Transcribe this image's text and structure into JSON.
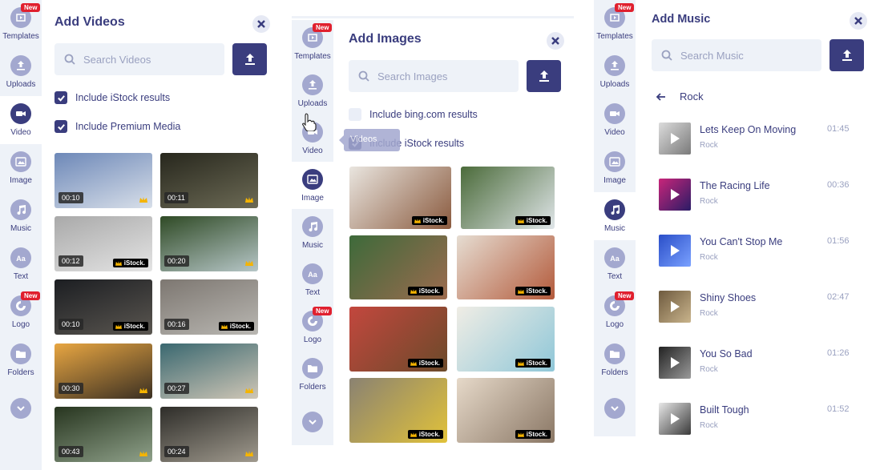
{
  "panel1": {
    "rail": [
      {
        "label": "Templates",
        "icon": "templates-icon",
        "badge": "New",
        "active": false
      },
      {
        "label": "Uploads",
        "icon": "uploads-icon",
        "active": false
      },
      {
        "label": "Video",
        "icon": "video-icon",
        "active": true
      },
      {
        "label": "Image",
        "icon": "image-icon",
        "active": false
      },
      {
        "label": "Music",
        "icon": "music-icon",
        "active": false
      },
      {
        "label": "Text",
        "icon": "text-icon",
        "active": false
      },
      {
        "label": "Logo",
        "icon": "logo-icon",
        "badge": "New",
        "active": false
      },
      {
        "label": "Folders",
        "icon": "folders-icon",
        "active": false
      },
      {
        "label": "",
        "icon": "chevron-down-icon",
        "active": false
      }
    ],
    "title": "Add Videos",
    "search_placeholder": "Search Videos",
    "checks": [
      {
        "label": "Include iStock results",
        "checked": true
      },
      {
        "label": "Include Premium Media",
        "checked": true
      }
    ],
    "videos": [
      {
        "duration": "00:10",
        "mark": "crown",
        "colors": [
          "#6d88b8",
          "#d8dfe9"
        ]
      },
      {
        "duration": "00:11",
        "mark": "crown",
        "colors": [
          "#27271d",
          "#6c6a55"
        ]
      },
      {
        "duration": "00:12",
        "mark": "iStock.",
        "colors": [
          "#a9a9a9",
          "#e4e4e4"
        ]
      },
      {
        "duration": "00:20",
        "mark": "crown",
        "colors": [
          "#2f4a25",
          "#b6c6c7"
        ]
      },
      {
        "duration": "00:10",
        "mark": "iStock.",
        "colors": [
          "#1c1e22",
          "#5a5650"
        ]
      },
      {
        "duration": "00:16",
        "mark": "iStock.",
        "colors": [
          "#7d7771",
          "#b9b7b2"
        ]
      },
      {
        "duration": "00:30",
        "mark": "crown",
        "colors": [
          "#e8a642",
          "#3a2f22"
        ]
      },
      {
        "duration": "00:27",
        "mark": "crown",
        "colors": [
          "#3a6870",
          "#cfc6b6"
        ]
      },
      {
        "duration": "00:43",
        "mark": "crown",
        "colors": [
          "#27351f",
          "#8fa18a"
        ]
      },
      {
        "duration": "00:24",
        "mark": "crown",
        "colors": [
          "#2e2d29",
          "#a09a8e"
        ]
      }
    ]
  },
  "panel2": {
    "rail": [
      {
        "label": "Templates",
        "icon": "templates-icon",
        "badge": "New",
        "active": false
      },
      {
        "label": "Uploads",
        "icon": "uploads-icon",
        "active": false
      },
      {
        "label": "Video",
        "icon": "video-icon",
        "active": false
      },
      {
        "label": "Image",
        "icon": "image-icon",
        "active": true
      },
      {
        "label": "Music",
        "icon": "music-icon",
        "active": false
      },
      {
        "label": "Text",
        "icon": "text-icon",
        "active": false
      },
      {
        "label": "Logo",
        "icon": "logo-icon",
        "badge": "New",
        "active": false
      },
      {
        "label": "Folders",
        "icon": "folders-icon",
        "active": false
      },
      {
        "label": "",
        "icon": "chevron-down-icon",
        "active": false
      }
    ],
    "title": "Add Images",
    "search_placeholder": "Search Images",
    "checks": [
      {
        "label": "Include bing.com results",
        "checked": false
      },
      {
        "label": "Include iStock results",
        "checked": true
      }
    ],
    "tooltip": "Videos",
    "images": [
      {
        "mark": "iStock.",
        "colors": [
          "#e9e5df",
          "#8a5a3e"
        ]
      },
      {
        "mark": "iStock.",
        "colors": [
          "#4b6b3a",
          "#dfe5e8"
        ]
      },
      {
        "mark": "iStock.",
        "colors": [
          "#3d6a3a",
          "#9c6b4f"
        ]
      },
      {
        "mark": "iStock.",
        "colors": [
          "#e6ddd2",
          "#b35a3b"
        ]
      },
      {
        "mark": "iStock.",
        "colors": [
          "#c3473e",
          "#6b4a2a"
        ]
      },
      {
        "mark": "iStock.",
        "colors": [
          "#f0ede5",
          "#8fc7d8"
        ]
      },
      {
        "mark": "iStock.",
        "colors": [
          "#8a8272",
          "#e1c23a"
        ]
      },
      {
        "mark": "iStock.",
        "colors": [
          "#e6d9c9",
          "#8a7765"
        ]
      }
    ]
  },
  "panel3": {
    "rail": [
      {
        "label": "Templates",
        "icon": "templates-icon",
        "badge": "New",
        "active": false
      },
      {
        "label": "Uploads",
        "icon": "uploads-icon",
        "active": false
      },
      {
        "label": "Video",
        "icon": "video-icon",
        "active": false
      },
      {
        "label": "Image",
        "icon": "image-icon",
        "active": false
      },
      {
        "label": "Music",
        "icon": "music-icon",
        "active": true
      },
      {
        "label": "Text",
        "icon": "text-icon",
        "active": false
      },
      {
        "label": "Logo",
        "icon": "logo-icon",
        "badge": "New",
        "active": false
      },
      {
        "label": "Folders",
        "icon": "folders-icon",
        "active": false
      },
      {
        "label": "",
        "icon": "chevron-down-icon",
        "active": false
      }
    ],
    "title": "Add Music",
    "search_placeholder": "Search Music",
    "genre": "Rock",
    "tracks": [
      {
        "name": "Lets Keep On Moving",
        "genre": "Rock",
        "duration": "01:45",
        "colors": [
          "#dcdcdc",
          "#7a7a7a"
        ]
      },
      {
        "name": "The Racing Life",
        "genre": "Rock",
        "duration": "00:36",
        "colors": [
          "#c9257a",
          "#2a1c66"
        ]
      },
      {
        "name": "You Can't Stop Me",
        "genre": "Rock",
        "duration": "01:56",
        "colors": [
          "#2a4ec8",
          "#7aa1ff"
        ]
      },
      {
        "name": "Shiny Shoes",
        "genre": "Rock",
        "duration": "02:47",
        "colors": [
          "#6e5a3e",
          "#c9b48c"
        ]
      },
      {
        "name": "You So Bad",
        "genre": "Rock",
        "duration": "01:26",
        "colors": [
          "#222",
          "#9a9a9a"
        ]
      },
      {
        "name": "Built Tough",
        "genre": "Rock",
        "duration": "01:52",
        "colors": [
          "#e8e8e8",
          "#3a3a3a"
        ]
      }
    ]
  },
  "colors": {
    "accent": "#3a3d7e",
    "rail_bg": "#eef2f8",
    "icon_muted": "#a3a8cf",
    "badge": "#e0202e"
  }
}
